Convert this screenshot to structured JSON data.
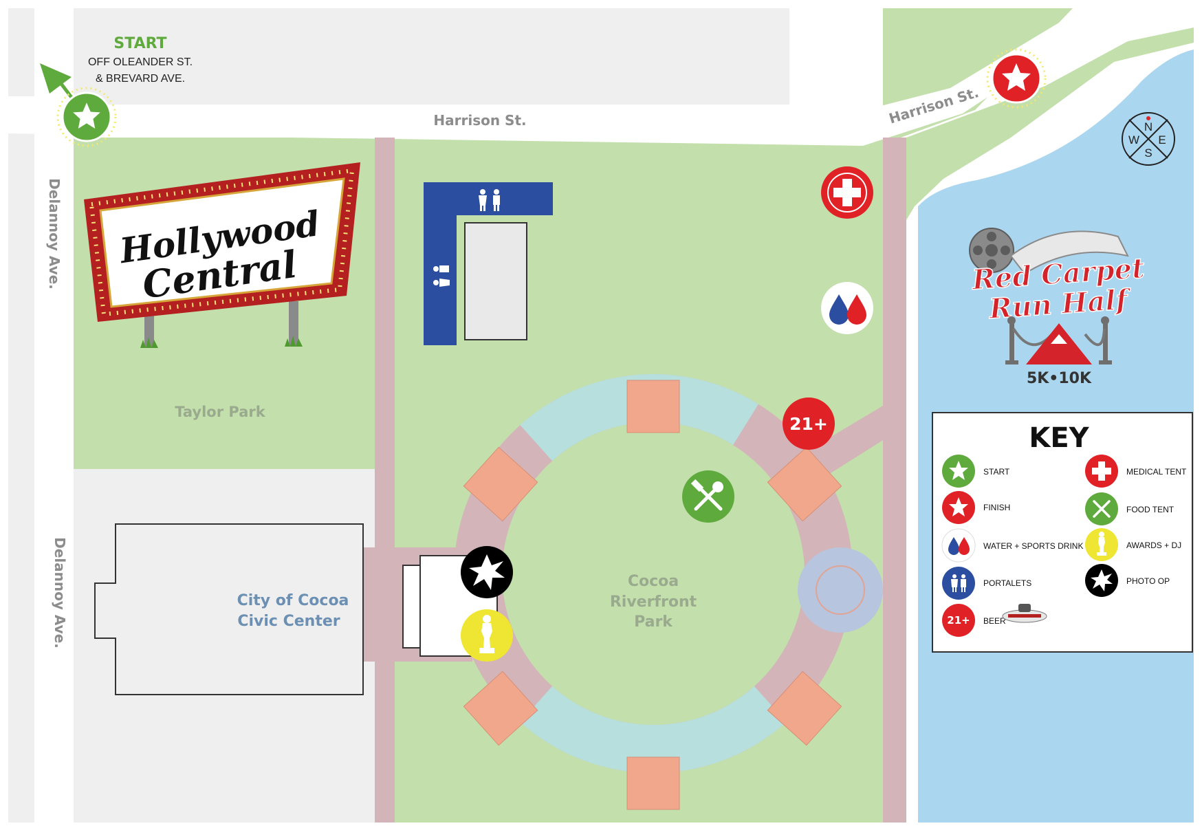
{
  "start_label": {
    "title": "START",
    "line1": "OFF OLEANDER ST.",
    "line2": "& BREVARD AVE."
  },
  "streets": {
    "harrison_west": "Harrison St.",
    "harrison_east": "Harrison St.",
    "delannoy_north": "Delannoy Ave.",
    "delannoy_south": "Delannoy Ave."
  },
  "areas": {
    "taylor_park": "Taylor Park",
    "civic_center_line1": "City of Cocoa",
    "civic_center_line2": "Civic Center",
    "riverfront_line1": "Cocoa",
    "riverfront_line2": "Riverfront",
    "riverfront_line3": "Park"
  },
  "sign": {
    "line1": "Hollywood",
    "line2": "Central"
  },
  "event_logo": {
    "line1": "Red Carpet",
    "line2": "Run Half",
    "distances": "5K•10K"
  },
  "compass": {
    "n": "N",
    "e": "E",
    "s": "S",
    "w": "W"
  },
  "beer_marker": "21+",
  "key": {
    "title": "KEY",
    "items": [
      {
        "icon": "start-star-icon",
        "label": "START"
      },
      {
        "icon": "medical-cross-icon",
        "label": "MEDICAL TENT"
      },
      {
        "icon": "finish-star-icon",
        "label": "FINISH"
      },
      {
        "icon": "food-fork-spoon-icon",
        "label": "FOOD TENT"
      },
      {
        "icon": "water-drops-icon",
        "label": "WATER + SPORTS DRINK"
      },
      {
        "icon": "oscar-statue-icon",
        "label": "AWARDS + DJ"
      },
      {
        "icon": "restroom-icon",
        "label": "PORTALETS"
      },
      {
        "icon": "photo-burst-icon",
        "label": "PHOTO OP"
      },
      {
        "icon": "beer-21-icon",
        "label": "BEER",
        "badge": "21+"
      }
    ]
  },
  "colors": {
    "grass": "#c3dfac",
    "water": "#abd6ef",
    "road": "#ffffff",
    "block": "#efefef",
    "path": "#d3b5b9",
    "plaza_ring": "#b6dfde",
    "plaza_tile": "#f0a78c",
    "start_green": "#5faa3c",
    "marker_red": "#e02227",
    "restroom_blue": "#2b4ea0",
    "awards_yellow": "#efe633",
    "label_gray": "#8c8c8c",
    "civic_blue": "#6c90b4"
  }
}
